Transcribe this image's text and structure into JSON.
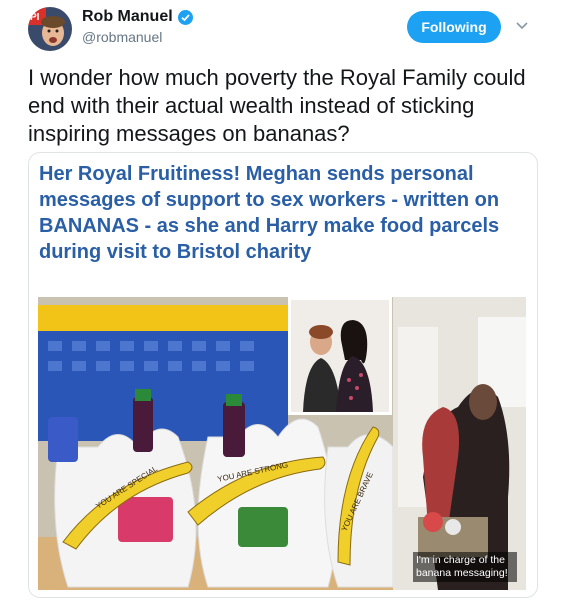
{
  "user": {
    "display_name": "Rob Manuel",
    "handle": "@robmanuel",
    "verified": true,
    "avatar_badge": "PI"
  },
  "follow_button": {
    "label": "Following"
  },
  "tweet": {
    "text": "I wonder how much poverty the Royal Family could end with their actual wealth instead of sticking inspiring messages on bananas?"
  },
  "card": {
    "headline": "Her Royal Fruitiness! Meghan sends personal messages of support to sex workers - written on BANANAS - as she and Harry make food parcels during visit to Bristol charity",
    "photo_caption": "I'm in charge of the banana messaging!",
    "banana_messages": [
      "YOU ARE SPECIAL",
      "YOU ARE STRONG",
      "YOU ARE BRAVE"
    ]
  },
  "colors": {
    "accent": "#1da1f2",
    "headline": "#2a5fa6",
    "text": "#14171a",
    "muted": "#657786"
  }
}
